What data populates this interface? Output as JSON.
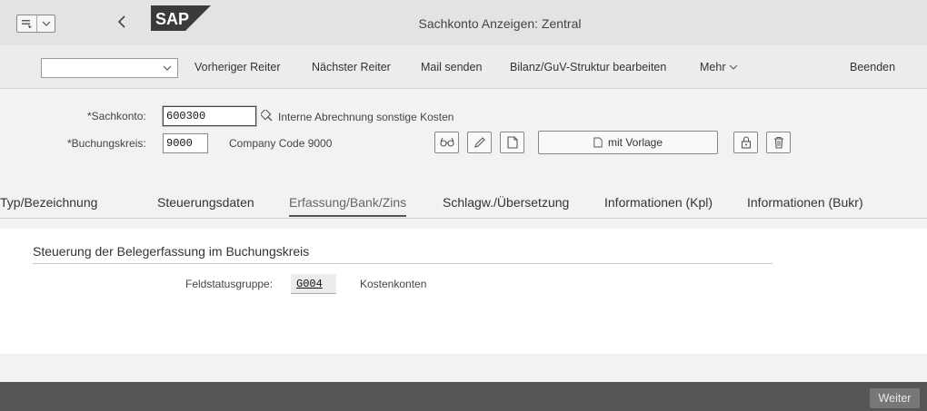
{
  "window": {
    "title": "Sachkonto Anzeigen: Zentral"
  },
  "titlebar": {
    "menu_icon": "menu-icon",
    "dropdown_icon": "chevron-down-icon",
    "back_icon": "chevron-left-icon",
    "logo_text": "SAP",
    "logo_color": "#3a3a3a"
  },
  "toolbar": {
    "combo_value": "",
    "items": [
      {
        "label": "Vorheriger Reiter"
      },
      {
        "label": "Nächster Reiter"
      },
      {
        "label": "Mail senden"
      },
      {
        "label": "Bilanz/GuV-Struktur bearbeiten"
      },
      {
        "label": "Mehr"
      },
      {
        "label": "Beenden"
      }
    ]
  },
  "header": {
    "sachkonto_label": "*Sachkonto:",
    "sachkonto_value": "600300",
    "sachkonto_desc": "Interne Abrechnung sonstige Kosten",
    "buchungskreis_label": "*Buchungskreis:",
    "buchungskreis_value": "9000",
    "buchungskreis_desc": "Company Code 9000",
    "vorlage_label": "mit Vorlage",
    "buttons": [
      "glasses-icon",
      "pencil-icon",
      "document-icon",
      "lock-icon",
      "trash-icon"
    ]
  },
  "tabs": [
    {
      "label": "Typ/Bezeichnung"
    },
    {
      "label": "Steuerungsdaten"
    },
    {
      "label": "Erfassung/Bank/Zins",
      "active": true
    },
    {
      "label": "Schlagw./Übersetzung"
    },
    {
      "label": "Informationen (Kpl)"
    },
    {
      "label": "Informationen (Bukr)"
    }
  ],
  "content": {
    "group_title": "Steuerung der Belegerfassung im Buchungskreis",
    "field_label": "Feldstatusgruppe:",
    "field_value": "G004",
    "field_desc": "Kostenkonten"
  },
  "footer": {
    "weiter_label": "Weiter"
  }
}
